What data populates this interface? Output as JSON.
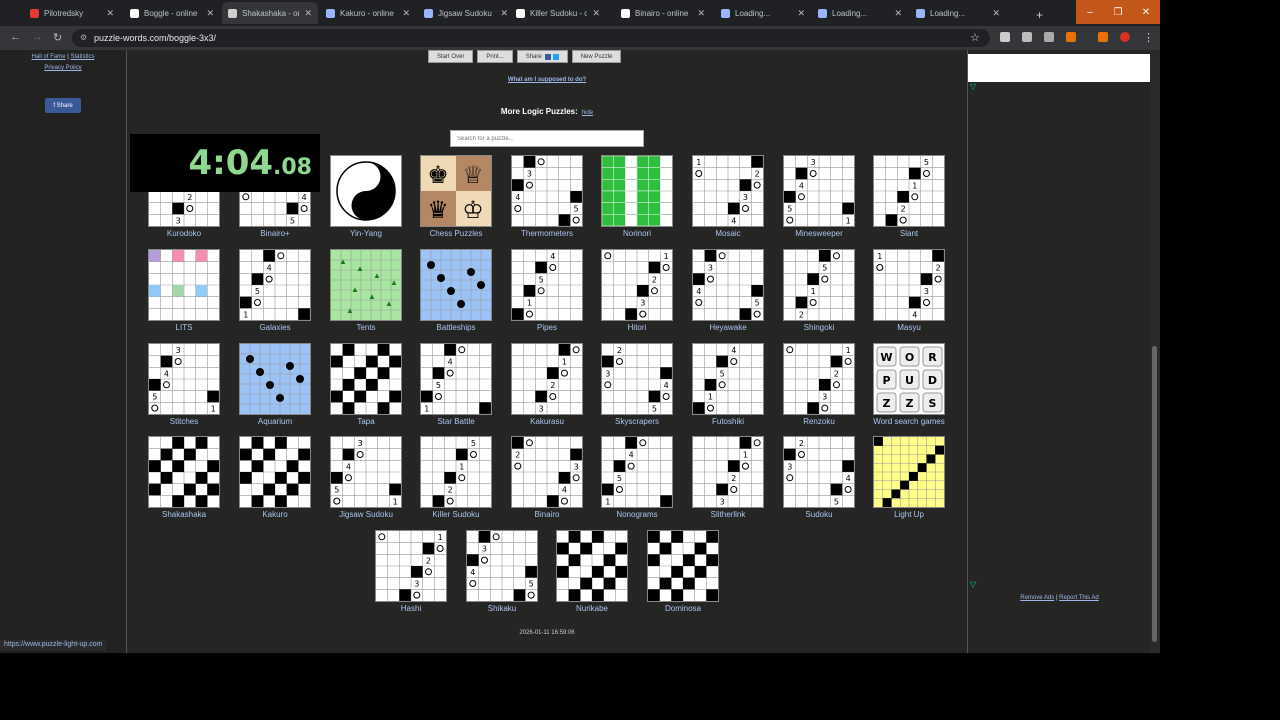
{
  "tabs": [
    {
      "title": "Pilotredsky",
      "color": "#e53935",
      "muted": true
    },
    {
      "title": "Boggle - online",
      "color": "#ffffff"
    },
    {
      "title": "Shakashaka - onl",
      "color": "#cfcfcf",
      "active": true
    },
    {
      "title": "Kakuro - online",
      "color": "#9ab4ff"
    },
    {
      "title": "Jigsaw Sudoku",
      "color": "#9ab4ff"
    },
    {
      "title": "Killer Sudoku - o",
      "color": "#ffffff"
    },
    {
      "title": "Binairo - online",
      "color": "#ffffff"
    },
    {
      "title": "Loading...",
      "color": "#9ab4ff"
    },
    {
      "title": "Loading...",
      "color": "#9ab4ff"
    },
    {
      "title": "Loading...",
      "color": "#9ab4ff"
    }
  ],
  "window": {
    "minimize": "–",
    "restore": "❐",
    "close": "✕",
    "new_tab": "+"
  },
  "address": {
    "url": "puzzle-words.com/boggle-3x3/",
    "back": "←",
    "forward": "→",
    "reload": "↻",
    "star": "☆",
    "menu": "⋮"
  },
  "left": {
    "hall_of_fame": "Hall of Fame",
    "sep": "|",
    "statistics": "Statistics",
    "privacy": "Privacy Policy",
    "share": "f Share"
  },
  "toolbar": {
    "start_over": "Start Over",
    "print": "Print...",
    "share": "Share",
    "new_puzzle": "New Puzzle"
  },
  "what": "What am I supposed to do?",
  "more_title": "More Logic Puzzles:",
  "hide": "hide",
  "search_placeholder": "Search for a puzzle...",
  "timer": {
    "main": "4:04",
    "fraction": ".08"
  },
  "puzzles": [
    "Kurodoko",
    "Binairo+",
    "Yin-Yang",
    "Chess Puzzles",
    "Thermometers",
    "Norinori",
    "Mosaic",
    "Minesweeper",
    "Slant",
    "LITS",
    "Galaxies",
    "Tents",
    "Battleships",
    "Pipes",
    "Hitori",
    "Heyawake",
    "Shingoki",
    "Masyu",
    "Stitches",
    "Aquarium",
    "Tapa",
    "Star Battle",
    "Kakurasu",
    "Skyscrapers",
    "Futoshiki",
    "Renzoku",
    "Word search games",
    "Shakashaka",
    "Kakuro",
    "Jigsaw Sudoku",
    "Killer Sudoku",
    "Binairo",
    "Nonograms",
    "Slitherlink",
    "Sudoku",
    "Light Up",
    "Hashi",
    "Shikaku",
    "Nurikabe",
    "Dominosa"
  ],
  "timestamp": "2026-01-11 16:59:06",
  "ads": {
    "remove": "Remove Ads",
    "sep": "|",
    "report": "Report This Ad"
  },
  "status_url": "https://www.puzzle-light-up.com"
}
